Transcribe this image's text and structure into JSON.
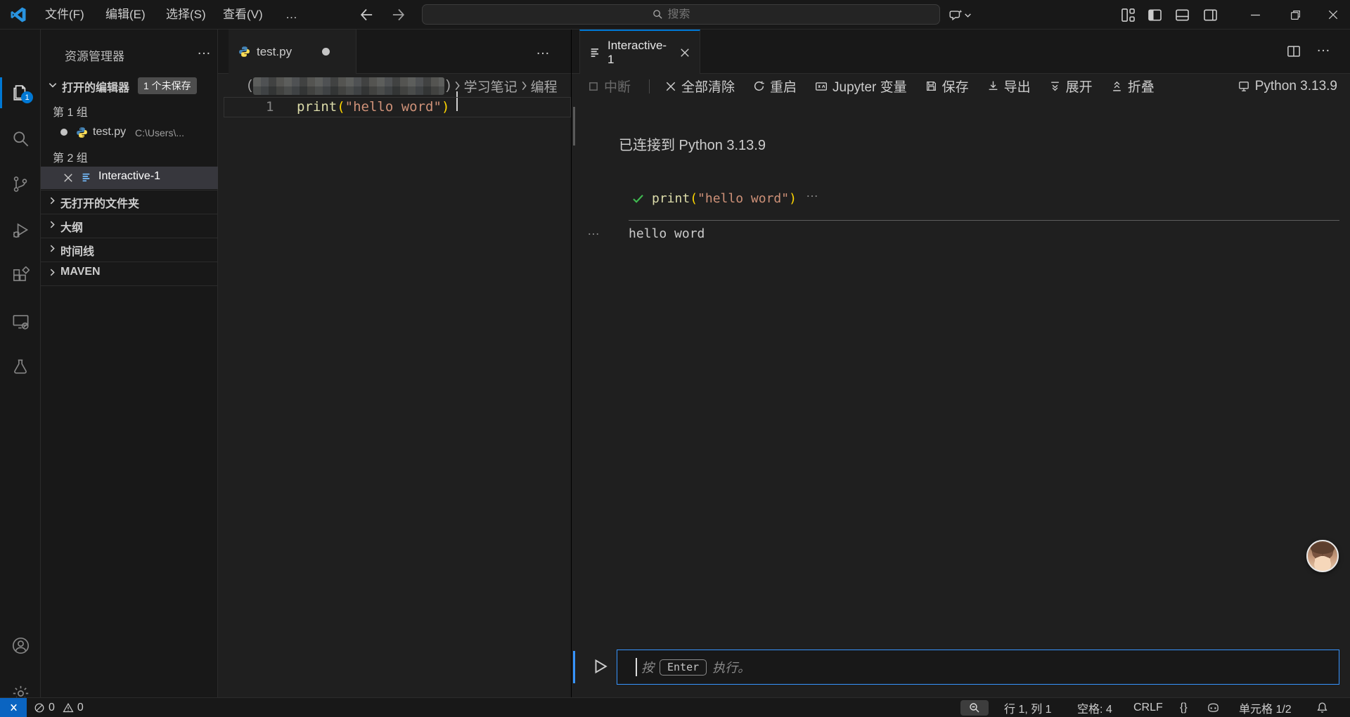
{
  "titlebar": {
    "menus": [
      "文件(F)",
      "编辑(E)",
      "选择(S)",
      "查看(V)"
    ],
    "search_placeholder": "搜索"
  },
  "activitybar": {
    "explorer_badge": "1"
  },
  "sidebar": {
    "title": "资源管理器",
    "open_editors_label": "打开的编辑器",
    "unsaved_badge": "1 个未保存",
    "group1_label": "第 1 组",
    "file1_name": "test.py",
    "file1_path": "C:\\Users\\...",
    "group2_label": "第 2 组",
    "file2_name": "Interactive-1",
    "sections": [
      "无打开的文件夹",
      "大纲",
      "时间线",
      "MAVEN"
    ]
  },
  "editor": {
    "tab_label": "test.py",
    "breadcrumb_open": "(",
    "breadcrumb_close": ")",
    "breadcrumb_seg1": "学习笔记",
    "breadcrumb_seg2": "编程",
    "line_number": "1",
    "code_fn": "print",
    "code_open": "(",
    "code_string": "\"hello word\"",
    "code_close": ")"
  },
  "interactive": {
    "tab_label": "Interactive-1",
    "btn_interrupt": "中断",
    "btn_clear": "全部清除",
    "btn_restart": "重启",
    "btn_variables": "Jupyter 变量",
    "btn_save": "保存",
    "btn_export": "导出",
    "btn_expand": "展开",
    "btn_collapse": "折叠",
    "kernel": "Python 3.13.9",
    "connected_msg": "已连接到 Python 3.13.9",
    "cell_code_fn": "print",
    "cell_code_open": "(",
    "cell_code_string": "\"hello word\"",
    "cell_code_close": ")",
    "cell_more": "…",
    "output_more": "…",
    "output_text": "hello word",
    "input_pre": "按",
    "input_kbd": "Enter",
    "input_post": "执行。"
  },
  "statusbar": {
    "errors": "0",
    "warnings": "0",
    "cursor_position": "行 1, 列 1",
    "indent": "空格: 4",
    "eol": "CRLF",
    "braces": "{}",
    "cell_indicator": "单元格 1/2"
  },
  "colors": {
    "accent": "#0078d4",
    "focus_border": "#3794ff",
    "string": "#ce9178",
    "function": "#dcdcaa",
    "bracket": "#ffd700"
  }
}
